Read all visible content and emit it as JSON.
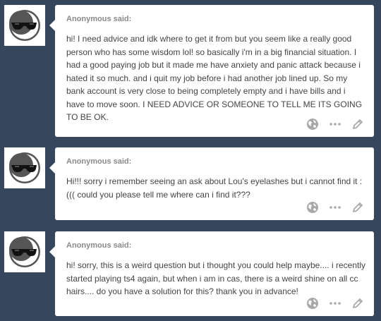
{
  "posts": [
    {
      "asker_label": "Anonymous said:",
      "question": "hi! I need advice and idk where to get it from but you seem like a really good person who has some wisdom lol! so basically i'm in a big financial situation. I had a good paying job but it made me have anxiety and panic attack because i hated it so much. and i quit my job before i had another job lined up. So my bank account is very close to being completely empty and i have bills and i have to move soon. I NEED ADVICE OR SOMEONE TO TELL ME ITS GOING TO BE OK."
    },
    {
      "asker_label": "Anonymous said:",
      "question": "Hi!!! sorry i remember seeing an ask about Lou's eyelashes but i cannot find it : ((( could you please tell me where can i find it???"
    },
    {
      "asker_label": "Anonymous said:",
      "question": "hi! sorry, this is a weird question but i thought you could help maybe.... i recently started playing ts4 again, but when i am in cas, there is a weird shine on all cc hairs.... do you have a solution for this? thank you in advance!"
    }
  ],
  "icons": {
    "avatar": "anonymous-sunglasses-face-icon",
    "globe": "globe-icon",
    "more": "ellipsis-icon",
    "edit": "pencil-icon"
  },
  "colors": {
    "background": "#36465d",
    "card": "#ffffff",
    "asker_text": "#8a8a8a",
    "question_text": "#444444",
    "action_icon": "#a9a9a9"
  }
}
